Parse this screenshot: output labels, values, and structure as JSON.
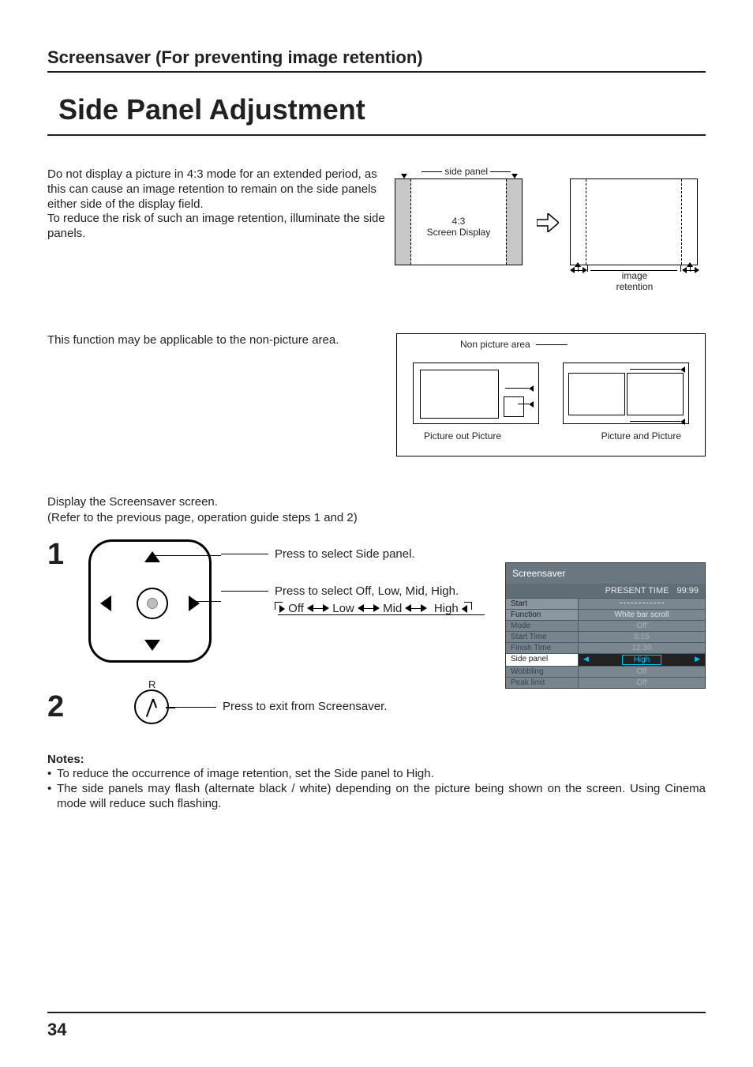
{
  "section_head": "Screensaver (For preventing image retention)",
  "page_title": "Side Panel Adjustment",
  "intro": {
    "p1": "Do not display a picture in 4:3 mode for an extended period, as this can cause an image retention to remain on the side panels either side of the display field.",
    "p2": "To reduce the risk of such an image retention, illuminate the side panels."
  },
  "dia1": {
    "side_panel_label": "side panel",
    "center_text_l1": "4:3",
    "center_text_l2": "Screen Display",
    "image_retention_l1": "image",
    "image_retention_l2": "retention"
  },
  "func_line": "This function may be applicable to the non-picture area.",
  "dia2": {
    "non_picture": "Non picture area",
    "pop": "Picture out Picture",
    "pap": "Picture and Picture"
  },
  "display_l1": "Display the Screensaver screen.",
  "display_l2": "(Refer to the previous page, operation guide steps 1 and 2)",
  "steps": {
    "n1": "1",
    "n2": "2",
    "s1a": "Press to select Side panel.",
    "s1b": "Press to select Off, Low, Mid, High.",
    "cycle_off": "Off",
    "cycle_low": "Low",
    "cycle_mid": "Mid",
    "cycle_high": "High",
    "s2": "Press to exit from Screensaver.",
    "r": "R"
  },
  "osd": {
    "title": "Screensaver",
    "pt_label": "PRESENT TIME",
    "pt_value": "99:99",
    "rows": [
      {
        "label": "Start",
        "value": ""
      },
      {
        "label": "Function",
        "value": "White bar scroll"
      },
      {
        "label": "Mode",
        "value": "Off"
      },
      {
        "label": "Start Time",
        "value": "6:15"
      },
      {
        "label": "Finish Time",
        "value": "12:30"
      },
      {
        "label": "Side panel",
        "value": "High"
      },
      {
        "label": "Wobbling",
        "value": "Off"
      },
      {
        "label": "Peak limit",
        "value": "Off"
      }
    ]
  },
  "notes": {
    "heading": "Notes:",
    "n1": "To reduce the occurrence of image retention, set the Side panel to High.",
    "n2": "The side panels may flash (alternate black / white) depending on the picture being shown on the screen. Using Cinema mode will reduce such flashing."
  },
  "page_number": "34"
}
